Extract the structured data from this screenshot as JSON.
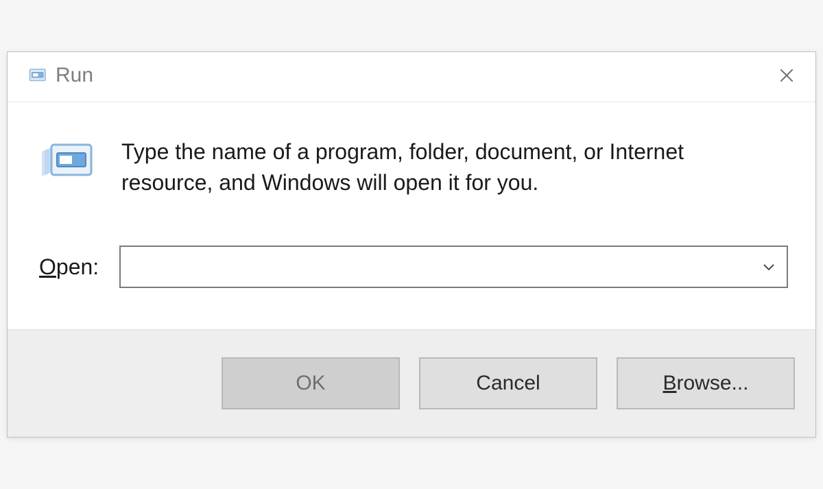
{
  "title": "Run",
  "description": "Type the name of a program, folder, document, or Internet resource, and Windows will open it for you.",
  "open_label_pre": "O",
  "open_label_rest": "pen:",
  "open_value": "",
  "buttons": {
    "ok": "OK",
    "cancel": "Cancel",
    "browse_pre": "B",
    "browse_rest": "rowse..."
  }
}
